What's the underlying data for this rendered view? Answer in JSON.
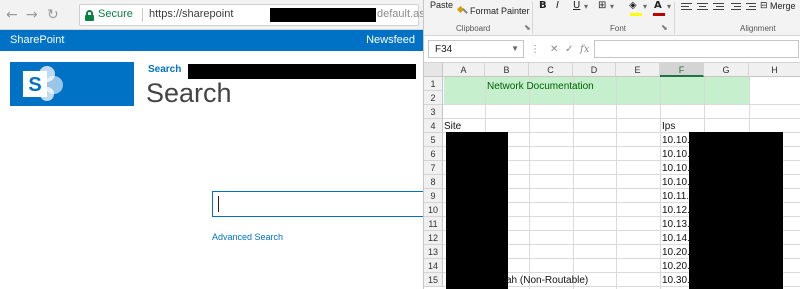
{
  "browser": {
    "back_icon": "arrow-left-icon",
    "forward_icon": "arrow-right-icon",
    "reload_icon": "reload-icon",
    "secure_label": "Secure",
    "url_prefix": "https://sharepoint",
    "url_suffix": "default.aspx"
  },
  "sharepoint": {
    "suite_title": "SharePoint",
    "newsfeed_label": "Newsfeed",
    "breadcrumb_label": "Search",
    "page_title": "Search",
    "search_placeholder": "",
    "advanced_search_label": "Advanced Search",
    "brand_color": "#0072c6"
  },
  "excel": {
    "ribbon": {
      "paste_label": "Paste",
      "format_painter_label": "Format Painter",
      "bold_label": "B",
      "italic_label": "I",
      "underline_label": "U",
      "merge_label": "Merge",
      "clipboard_group": "Clipboard",
      "font_group": "Font",
      "alignment_group": "Alignment"
    },
    "name_box": "F34",
    "formula": "",
    "columns": [
      "A",
      "B",
      "C",
      "D",
      "E",
      "F",
      "G",
      "H"
    ],
    "selected_column": "F",
    "rows": [
      "1",
      "2",
      "3",
      "4",
      "5",
      "6",
      "7",
      "8",
      "9",
      "10",
      "11",
      "12",
      "13",
      "14",
      "15"
    ],
    "title_cell": "Network Documentation",
    "header_site": "Site",
    "header_ips": "Ips",
    "ip_values": [
      "10.10.",
      "10.10.",
      "10.10.",
      "10.10.",
      "10.11.",
      "10.12.",
      "10.13.",
      "10.14.",
      "10.20.",
      "10.20.",
      "10.30."
    ],
    "row15_site_tail": "ah (Non-Routable)",
    "title_fill_color": "#c6efce",
    "title_text_color": "#006100"
  }
}
